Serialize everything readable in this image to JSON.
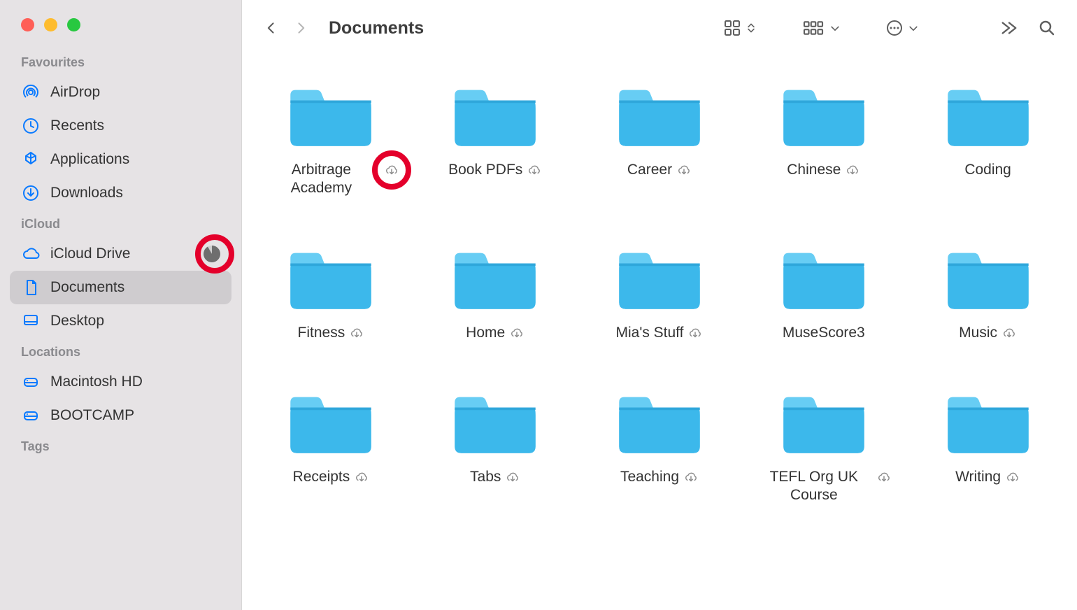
{
  "window": {
    "title": "Documents"
  },
  "traffic_lights": {
    "close": "close",
    "min": "minimize",
    "max": "maximize"
  },
  "sidebar": {
    "sections": [
      {
        "heading": "Favourites",
        "items": [
          {
            "icon": "airdrop-icon",
            "label": "AirDrop",
            "selected": false
          },
          {
            "icon": "recents-icon",
            "label": "Recents",
            "selected": false
          },
          {
            "icon": "applications-icon",
            "label": "Applications",
            "selected": false
          },
          {
            "icon": "downloads-icon",
            "label": "Downloads",
            "selected": false
          }
        ]
      },
      {
        "heading": "iCloud",
        "items": [
          {
            "icon": "cloud-icon",
            "label": "iCloud Drive",
            "selected": false,
            "has_storage_pie": true
          },
          {
            "icon": "document-icon",
            "label": "Documents",
            "selected": true
          },
          {
            "icon": "desktop-icon",
            "label": "Desktop",
            "selected": false
          }
        ]
      },
      {
        "heading": "Locations",
        "items": [
          {
            "icon": "disk-icon",
            "label": "Macintosh HD",
            "selected": false
          },
          {
            "icon": "disk-icon",
            "label": "BOOTCAMP",
            "selected": false
          }
        ]
      },
      {
        "heading": "Tags",
        "items": []
      }
    ]
  },
  "toolbar": {
    "back": "Back",
    "forward": "Forward",
    "view_mode": "icon-view",
    "group": "group",
    "action": "action",
    "more": "more",
    "search": "search"
  },
  "folders": [
    {
      "label": "Arbitrage Academy",
      "cloud": true,
      "annotated": true
    },
    {
      "label": "Book PDFs",
      "cloud": true
    },
    {
      "label": "Career",
      "cloud": true
    },
    {
      "label": "Chinese",
      "cloud": true
    },
    {
      "label": "Coding",
      "cloud": false
    },
    {
      "label": "Fitness",
      "cloud": true
    },
    {
      "label": "Home",
      "cloud": true
    },
    {
      "label": "Mia's Stuff",
      "cloud": true
    },
    {
      "label": "MuseScore3",
      "cloud": false
    },
    {
      "label": "Music",
      "cloud": true
    },
    {
      "label": "Receipts",
      "cloud": true
    },
    {
      "label": "Tabs",
      "cloud": true
    },
    {
      "label": "Teaching",
      "cloud": true
    },
    {
      "label": "TEFL Org UK Course",
      "cloud": true
    },
    {
      "label": "Writing",
      "cloud": true
    }
  ],
  "colors": {
    "accent": "#0a7aff",
    "folder_light": "#67cdf4",
    "folder_dark": "#3cb8eb",
    "annotation_red": "#e4002b"
  }
}
